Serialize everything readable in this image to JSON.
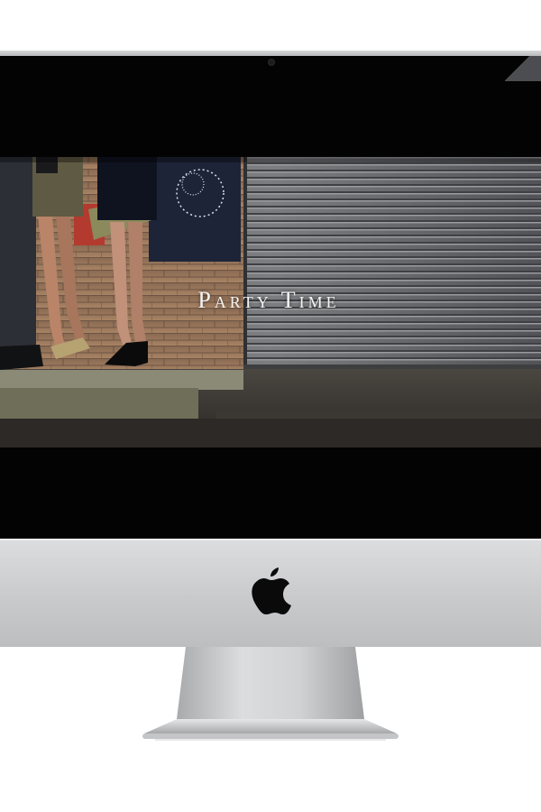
{
  "screen": {
    "title": "Party Time"
  },
  "brand": {
    "logo_icon": "apple-logo-icon"
  },
  "colors": {
    "bezel": "#030303",
    "aluminum": "#c9cacc",
    "title_text": "#f4f4f4"
  }
}
